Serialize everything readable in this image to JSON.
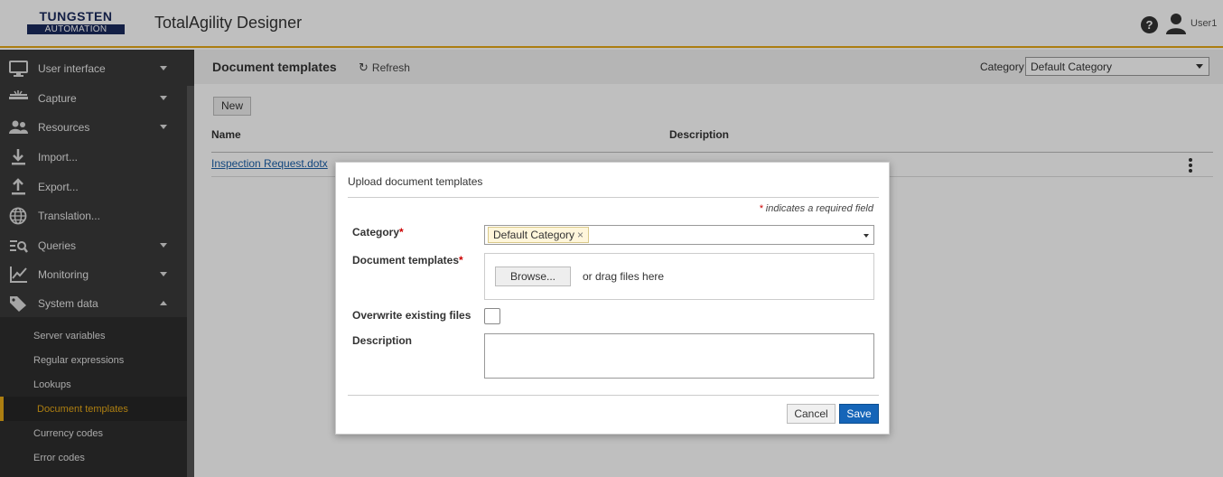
{
  "header": {
    "logo_top": "TUNGSTEN",
    "logo_bottom": "AUTOMATION",
    "app_title": "TotalAgility Designer",
    "help_glyph": "?",
    "user_name": "User1"
  },
  "sidebar": {
    "items": [
      {
        "label": "User interface",
        "icon": "monitor-icon",
        "expandable": true
      },
      {
        "label": "Capture",
        "icon": "scanner-icon",
        "expandable": true
      },
      {
        "label": "Resources",
        "icon": "people-icon",
        "expandable": true
      },
      {
        "label": "Import...",
        "icon": "download-icon",
        "expandable": false
      },
      {
        "label": "Export...",
        "icon": "upload-icon",
        "expandable": false
      },
      {
        "label": "Translation...",
        "icon": "globe-icon",
        "expandable": false
      },
      {
        "label": "Queries",
        "icon": "query-icon",
        "expandable": true
      },
      {
        "label": "Monitoring",
        "icon": "chart-icon",
        "expandable": true
      },
      {
        "label": "System data",
        "icon": "tag-icon",
        "expandable": true,
        "expanded": true
      }
    ],
    "sub_items": [
      {
        "label": "Server variables"
      },
      {
        "label": "Regular expressions"
      },
      {
        "label": "Lookups"
      },
      {
        "label": "Document templates",
        "active": true
      },
      {
        "label": "Currency codes"
      },
      {
        "label": "Error codes"
      }
    ]
  },
  "main": {
    "title": "Document templates",
    "refresh_label": "Refresh",
    "category_label": "Category",
    "category_value": "Default Category",
    "new_label": "New",
    "columns": {
      "name": "Name",
      "description": "Description"
    },
    "rows": [
      {
        "name": "Inspection Request.dotx",
        "description": ""
      }
    ]
  },
  "dialog": {
    "title": "Upload document templates",
    "required_note_star": "*",
    "required_note": " indicates a required field",
    "category_label": "Category",
    "category_tag": "Default Category",
    "tag_remove": "×",
    "templates_label": "Document templates",
    "browse_label": "Browse...",
    "drag_text": "or drag files here",
    "overwrite_label": "Overwrite existing files",
    "overwrite_checked": false,
    "description_label": "Description",
    "description_value": "",
    "cancel_label": "Cancel",
    "save_label": "Save",
    "required_star": "*"
  },
  "colors": {
    "accent": "#e6a817",
    "brand": "#1a2a5c",
    "primary_button": "#1565b8",
    "sidebar_bg": "#3a3a3a"
  }
}
